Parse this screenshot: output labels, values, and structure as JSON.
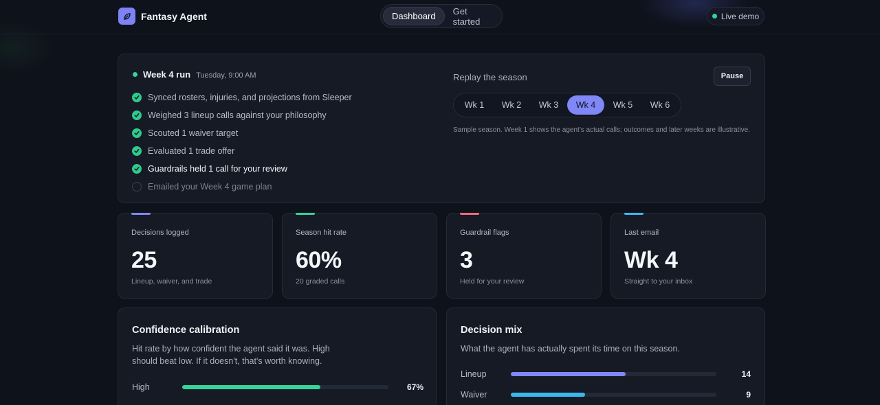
{
  "header": {
    "brand": "Fantasy Agent",
    "tabs": [
      {
        "label": "Dashboard",
        "active": true
      },
      {
        "label": "Get started",
        "active": false
      }
    ],
    "live_label": "Live demo"
  },
  "run": {
    "title": "Week 4 run",
    "time": "Tuesday, 9:00 AM",
    "steps": [
      {
        "label": "Synced rosters, injuries, and projections from Sleeper",
        "done": true
      },
      {
        "label": "Weighed 3 lineup calls against your philosophy",
        "done": true
      },
      {
        "label": "Scouted 1 waiver target",
        "done": true
      },
      {
        "label": "Evaluated 1 trade offer",
        "done": true
      },
      {
        "label": "Guardrails held 1 call for your review",
        "done": true
      },
      {
        "label": "Emailed your Week 4 game plan",
        "done": false
      }
    ],
    "replay_label": "Replay the season",
    "pause_label": "Pause",
    "weeks": [
      "Wk 1",
      "Wk 2",
      "Wk 3",
      "Wk 4",
      "Wk 5",
      "Wk 6"
    ],
    "active_week": "Wk 4",
    "note": "Sample season. Week 1 shows the agent's actual calls; outcomes and later weeks are illustrative."
  },
  "stats": [
    {
      "label": "Decisions logged",
      "value": "25",
      "sub": "Lineup, waiver, and trade",
      "accent": "#8087f7"
    },
    {
      "label": "Season hit rate",
      "value": "60%",
      "sub": "20 graded calls",
      "accent": "#35d399"
    },
    {
      "label": "Guardrail flags",
      "value": "3",
      "sub": "Held for your review",
      "accent": "#f06b7e"
    },
    {
      "label": "Last email",
      "value": "Wk 4",
      "sub": "Straight to your inbox",
      "accent": "#3bb7f0"
    }
  ],
  "calibration": {
    "title": "Confidence calibration",
    "desc": "Hit rate by how confident the agent said it was. High should beat low. If it doesn't, that's worth knowing.",
    "rows": [
      {
        "label": "High",
        "value": "67%",
        "fraction": 0.67,
        "color": "#35d399"
      }
    ]
  },
  "mix": {
    "title": "Decision mix",
    "desc": "What the agent has actually spent its time on this season.",
    "rows": [
      {
        "label": "Lineup",
        "value": "14",
        "fraction": 0.56,
        "color": "#8087f7"
      },
      {
        "label": "Waiver",
        "value": "9",
        "fraction": 0.36,
        "color": "#3bb7f0"
      }
    ]
  }
}
